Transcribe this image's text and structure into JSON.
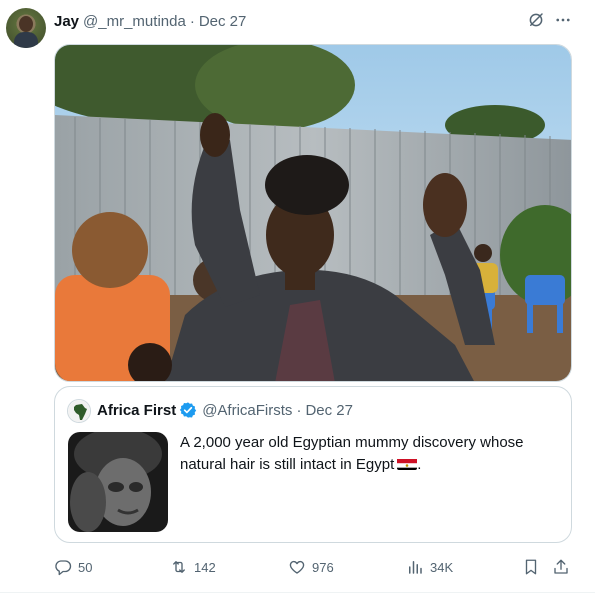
{
  "author": {
    "name": "Jay",
    "handle": "@_mr_mutinda",
    "separator": "·",
    "date": "Dec 27"
  },
  "media": {
    "icon": "photo-two-men-gesturing"
  },
  "quoted": {
    "name": "Africa First",
    "handle": "@AfricaFirsts",
    "separator": "·",
    "date": "Dec 27",
    "text": "A 2,000 year old Egyptian mummy discovery whose natural hair is still intact in Egypt",
    "text_suffix": ".",
    "verified_color": "#1d9bf0"
  },
  "actions": {
    "replies": "50",
    "reposts": "142",
    "likes": "976",
    "views": "34K"
  },
  "colors": {
    "muted": "#536471",
    "border": "#cfd9de",
    "accent": "#1d9bf0"
  }
}
